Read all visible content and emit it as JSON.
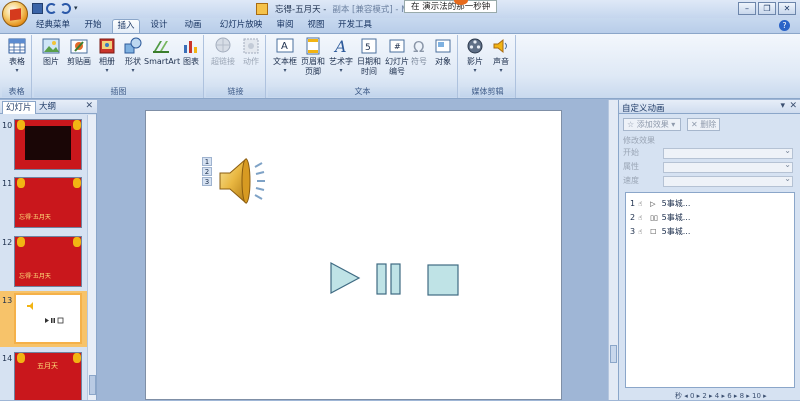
{
  "title_bar": {
    "title": "忘得-五月天 -",
    "title_tail": "副本 [兼容模式] - Microsoft PowerPoint",
    "tooltip": "在        演示法的那一秒钟",
    "win_minimize": "–",
    "win_restore": "❐",
    "win_close": "✕"
  },
  "tabs": [
    {
      "label": "经典菜单"
    },
    {
      "label": "开始"
    },
    {
      "label": "插入",
      "active": true
    },
    {
      "label": "设计"
    },
    {
      "label": "动画"
    },
    {
      "label": "幻灯片放映"
    },
    {
      "label": "审阅"
    },
    {
      "label": "视图"
    },
    {
      "label": "开发工具"
    }
  ],
  "ribbon": {
    "groups": {
      "table": "表格",
      "illustrations": "插图",
      "links": "链接",
      "text": "文本",
      "media": "媒体剪辑"
    },
    "buttons": {
      "table": "表格",
      "picture": "图片",
      "clipart": "剪贴画",
      "album": "相册",
      "shapes": "形状",
      "smartart": "SmartArt",
      "chart": "图表",
      "hyperlink": "超链接",
      "action": "动作",
      "textbox": "文本框",
      "header_footer_1": "页眉和",
      "header_footer_2": "页脚",
      "wordart": "艺术字",
      "datetime_1": "日期和",
      "datetime_2": "时间",
      "slideno_1": "幻灯片",
      "slideno_2": "编号",
      "symbol": "符号",
      "object": "对象",
      "movie": "影片",
      "sound": "声音"
    }
  },
  "left_pane": {
    "tab_slides": "幻灯片",
    "tab_outline": "大纲",
    "close": "✕",
    "slides": [
      {
        "num": "10",
        "caption": ""
      },
      {
        "num": "11",
        "caption": "忘得·五月天"
      },
      {
        "num": "12",
        "caption": "忘得·五月天"
      },
      {
        "num": "13",
        "caption": ""
      },
      {
        "num": "14",
        "caption": "五月天"
      }
    ]
  },
  "slide": {
    "tags": [
      "1",
      "2",
      "3"
    ]
  },
  "task_pane": {
    "title": "自定义动画",
    "add_effect": "添加效果",
    "remove": "删除",
    "modify_effect": "修改效果",
    "start_label": "开始",
    "property_label": "属性",
    "speed_label": "速度",
    "items": [
      {
        "index": "1",
        "icon": "▷",
        "text": "5事城..."
      },
      {
        "index": "2",
        "icon": "▯▯",
        "text": "5事城..."
      },
      {
        "index": "3",
        "icon": "☐",
        "text": "5事城..."
      }
    ],
    "bottom": "秒 ◂  0  ▸  2  ▸  4  ▸  6  ▸  8  ▸  10  ▸"
  },
  "colors": {
    "accent": "#2b63c7",
    "slide_red": "#c9171c",
    "shape_fill": "#bfe3e6",
    "shape_stroke": "#3f6b83"
  }
}
